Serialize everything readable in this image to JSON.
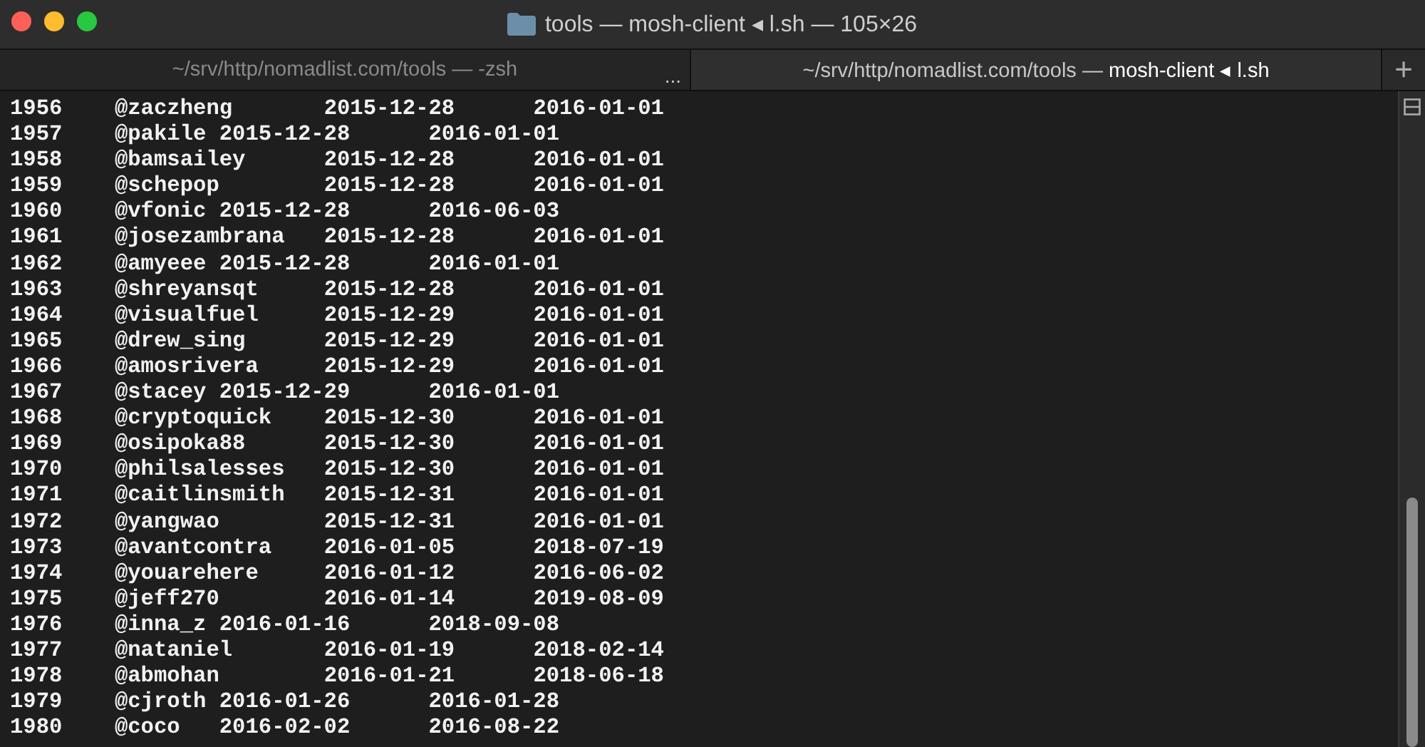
{
  "window": {
    "title": "tools — mosh-client ◂ l.sh — 105×26"
  },
  "tabs": [
    {
      "label": "~/srv/http/nomadlist.com/tools — -zsh",
      "selected": false,
      "overflow": "..."
    },
    {
      "label": "~/srv/http/nomadlist.com/tools — ",
      "label_bold": "mosh-client ◂ l.sh",
      "selected": true
    }
  ],
  "new_tab_button": "+",
  "lines": [
    "1956\t@zaczheng\t2015-12-28\t2016-01-01",
    "1957\t@pakile 2015-12-28\t2016-01-01",
    "1958\t@bamsailey\t2015-12-28\t2016-01-01",
    "1959\t@schepop\t2015-12-28\t2016-01-01",
    "1960\t@vfonic 2015-12-28\t2016-06-03",
    "1961\t@josezambrana\t2015-12-28\t2016-01-01",
    "1962\t@amyeee 2015-12-28\t2016-01-01",
    "1963\t@shreyansqt\t2015-12-28\t2016-01-01",
    "1964\t@visualfuel\t2015-12-29\t2016-01-01",
    "1965\t@drew_sing\t2015-12-29\t2016-01-01",
    "1966\t@amosrivera\t2015-12-29\t2016-01-01",
    "1967\t@stacey 2015-12-29\t2016-01-01",
    "1968\t@cryptoquick\t2015-12-30\t2016-01-01",
    "1969\t@osipoka88\t2015-12-30\t2016-01-01",
    "1970\t@philsalesses\t2015-12-30\t2016-01-01",
    "1971\t@caitlinsmith\t2015-12-31\t2016-01-01",
    "1972\t@yangwao\t2015-12-31\t2016-01-01",
    "1973\t@avantcontra\t2016-01-05\t2018-07-19",
    "1974\t@youarehere\t2016-01-12\t2016-06-02",
    "1975\t@jeff270\t2016-01-14\t2019-08-09",
    "1976\t@inna_z 2016-01-16\t2018-09-08",
    "1977\t@nataniel\t2016-01-19\t2018-02-14",
    "1978\t@abmohan\t2016-01-21\t2018-06-18",
    "1979\t@cjroth 2016-01-26\t2016-01-28",
    "1980\t@coco\t2016-02-02\t2016-08-22"
  ]
}
